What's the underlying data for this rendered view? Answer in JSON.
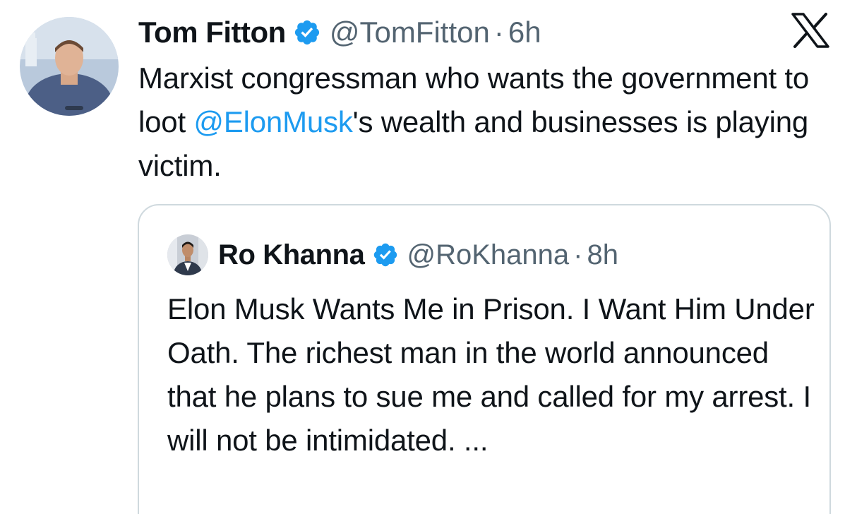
{
  "tweet": {
    "author_name": "Tom Fitton",
    "handle": "@TomFitton",
    "separator": "·",
    "time": "6h",
    "text_before": "Marxist congressman who wants the government to loot ",
    "mention": "@ElonMusk",
    "text_after": "'s wealth and businesses is playing victim.",
    "verified_badge_icon": "verified-badge-icon",
    "platform_icon": "x-logo-icon"
  },
  "quoted_tweet": {
    "author_name": "Ro Khanna",
    "handle": "@RoKhanna",
    "separator": "·",
    "time": "8h",
    "text": "Elon Musk Wants Me in Prison. I Want Him Under Oath. The richest man in the world announced that he plans to sue me and called for my arrest. I will not be intimidated. ...",
    "verified_badge_icon": "verified-badge-icon"
  },
  "colors": {
    "text": "#0f1419",
    "secondary": "#536471",
    "link": "#1d9bf0",
    "verified": "#1d9bf0",
    "border": "#cfd9de"
  }
}
